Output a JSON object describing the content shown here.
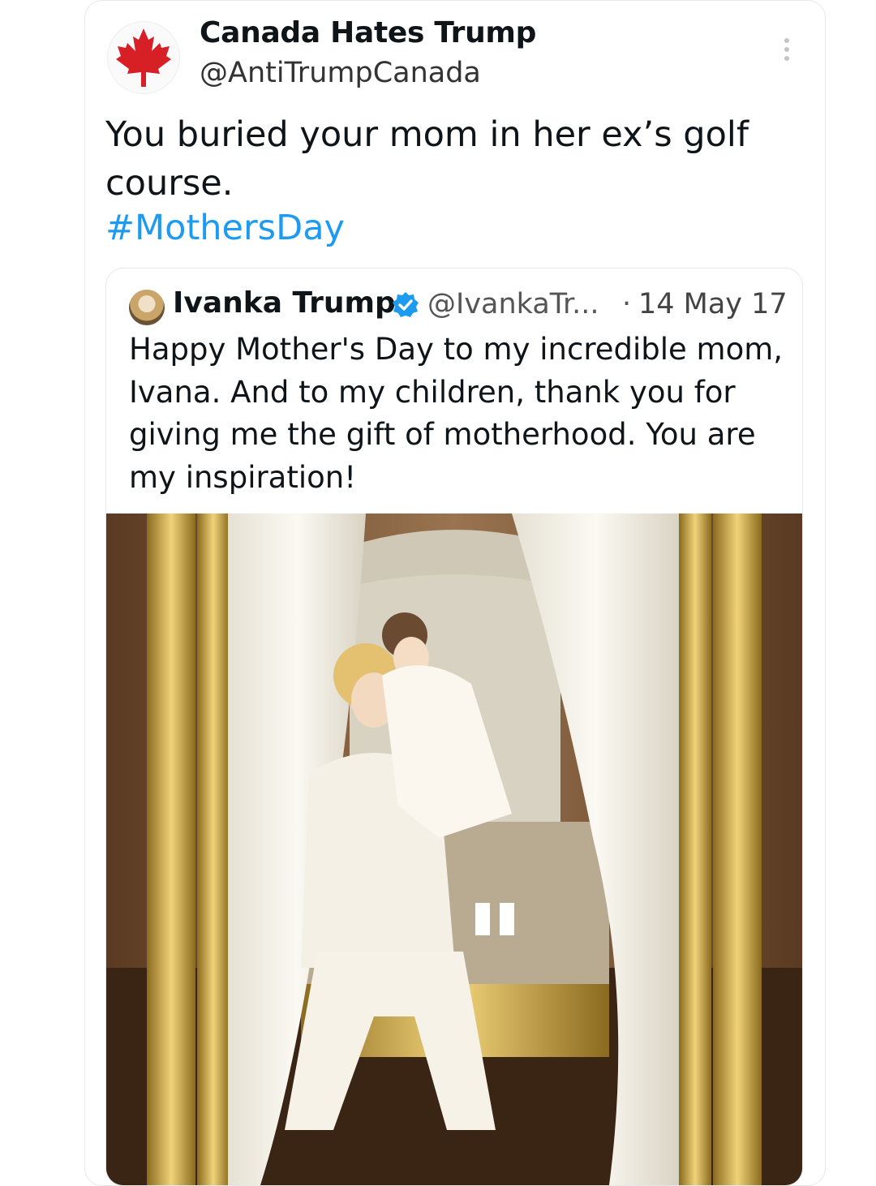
{
  "tweet": {
    "author_name": "Canada Hates Trump",
    "author_handle": "@AntiTrumpCanada",
    "avatar_icon": "maple-leaf-icon",
    "text": "You buried your mom in her ex’s golf course.",
    "hashtag": "#MothersDay",
    "more_icon": "more-vertical-icon"
  },
  "quoted_tweet": {
    "author_name": "Ivanka Trump",
    "verified_icon": "verified-badge-icon",
    "author_handle": "@IvankaTr...",
    "separator": "·",
    "date": "14 May 17",
    "text": "Happy Mother's Day to my incredible mom, Ivana. And to my children, thank you for giving me the gift of motherhood. You are my inspiration!"
  },
  "colors": {
    "accent": "#1d9bf0",
    "maple_red": "#d71f26",
    "gold": "#c9a23a"
  }
}
